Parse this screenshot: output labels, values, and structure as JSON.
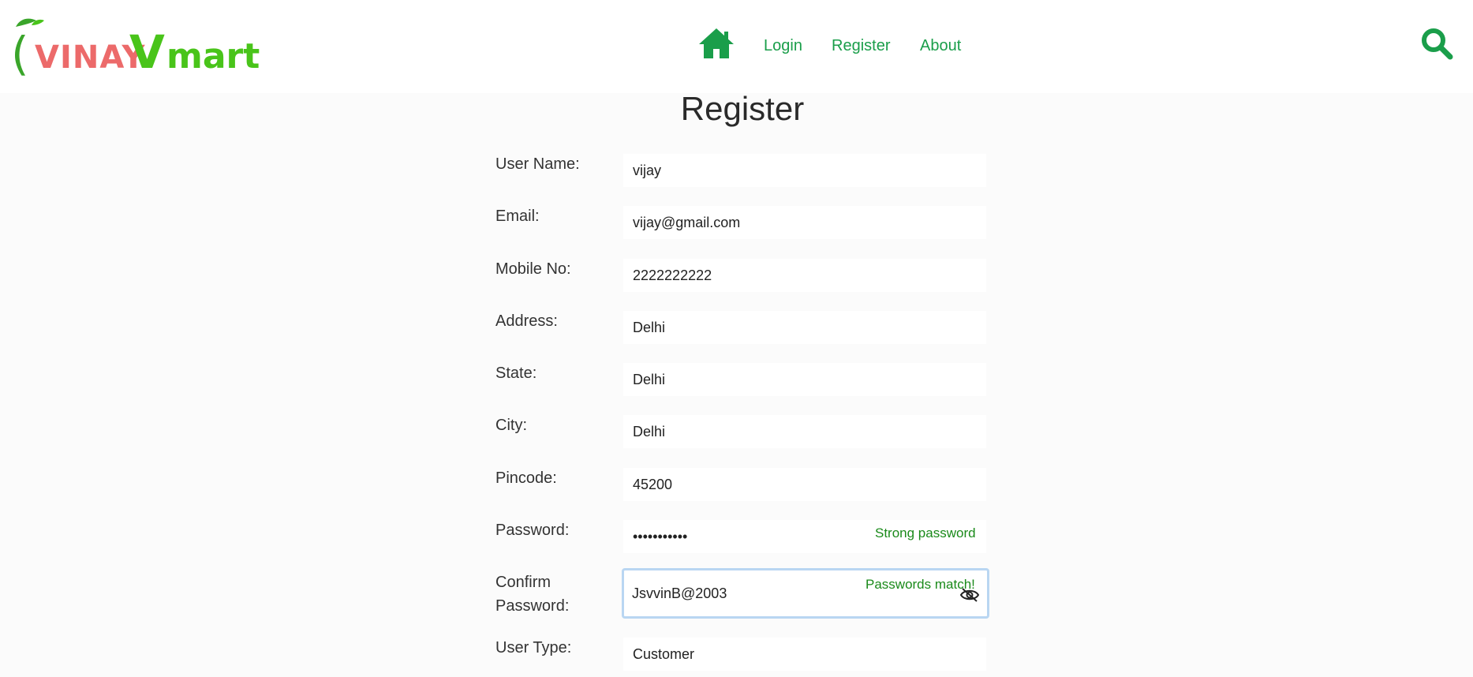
{
  "brand": {
    "logo_vinay": "VINAY",
    "logo_vmart_v": "V",
    "logo_vmart": "mart",
    "logo_c": "("
  },
  "nav": {
    "home_icon": "home-icon",
    "links": [
      "Login",
      "Register",
      "About"
    ],
    "search_icon": "search-icon"
  },
  "page": {
    "title": "Register"
  },
  "form": {
    "username": {
      "label": "User Name:",
      "value": "vijay"
    },
    "email": {
      "label": "Email:",
      "value": "vijay@gmail.com"
    },
    "mobile": {
      "label": "Mobile No:",
      "value": "2222222222"
    },
    "address": {
      "label": "Address:",
      "value": "Delhi"
    },
    "state": {
      "label": "State:",
      "value": "Delhi"
    },
    "city": {
      "label": "City:",
      "value": "Delhi"
    },
    "pincode": {
      "label": "Pincode:",
      "value": "45200"
    },
    "password": {
      "label": "Password:",
      "value": "•••••••••••",
      "hint": "Strong password"
    },
    "confirm_password": {
      "label_line1": "Confirm",
      "label_line2": "Password:",
      "value": "JsvvinB@2003",
      "hint": "Passwords match!",
      "toggle_icon": "eye-slash-icon"
    },
    "user_type": {
      "label": "User Type:",
      "value": "Customer"
    }
  },
  "colors": {
    "accent": "#1a9e4a",
    "hint": "#1a8a1a",
    "focus_border": "#b9d6f2",
    "logo_red": "#ec6a6a",
    "logo_green": "#49c41a"
  }
}
